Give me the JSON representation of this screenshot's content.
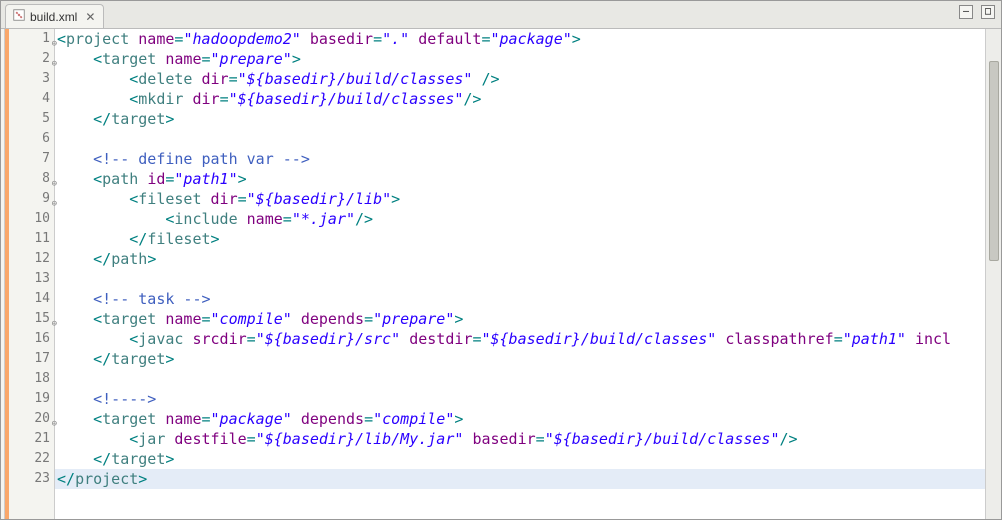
{
  "tab": {
    "filename": "build.xml",
    "close_glyph": "✕"
  },
  "fold_glyph": "⊖",
  "code": {
    "lines": [
      {
        "n": 1,
        "fold": true,
        "indent": 0,
        "segs": [
          {
            "c": "t-punc",
            "t": "<"
          },
          {
            "c": "t-tag",
            "t": "project"
          },
          {
            "c": "",
            "t": " "
          },
          {
            "c": "t-attr",
            "t": "name"
          },
          {
            "c": "t-punc",
            "t": "="
          },
          {
            "c": "t-str",
            "t": "\"hadoopdemo2\""
          },
          {
            "c": "",
            "t": " "
          },
          {
            "c": "t-attr",
            "t": "basedir"
          },
          {
            "c": "t-punc",
            "t": "="
          },
          {
            "c": "t-str",
            "t": "\".\""
          },
          {
            "c": "",
            "t": " "
          },
          {
            "c": "t-attr",
            "t": "default"
          },
          {
            "c": "t-punc",
            "t": "="
          },
          {
            "c": "t-str",
            "t": "\"package\""
          },
          {
            "c": "t-punc",
            "t": ">"
          }
        ]
      },
      {
        "n": 2,
        "fold": true,
        "indent": 1,
        "segs": [
          {
            "c": "t-punc",
            "t": "<"
          },
          {
            "c": "t-tag",
            "t": "target"
          },
          {
            "c": "",
            "t": " "
          },
          {
            "c": "t-attr",
            "t": "name"
          },
          {
            "c": "t-punc",
            "t": "="
          },
          {
            "c": "t-str",
            "t": "\"prepare\""
          },
          {
            "c": "t-punc",
            "t": ">"
          }
        ]
      },
      {
        "n": 3,
        "fold": false,
        "indent": 2,
        "segs": [
          {
            "c": "t-punc",
            "t": "<"
          },
          {
            "c": "t-tag",
            "t": "delete"
          },
          {
            "c": "",
            "t": " "
          },
          {
            "c": "t-attr",
            "t": "dir"
          },
          {
            "c": "t-punc",
            "t": "="
          },
          {
            "c": "t-str",
            "t": "\"${basedir}/build/classes\""
          },
          {
            "c": "",
            "t": " "
          },
          {
            "c": "t-punc",
            "t": "/>"
          }
        ]
      },
      {
        "n": 4,
        "fold": false,
        "indent": 2,
        "segs": [
          {
            "c": "t-punc",
            "t": "<"
          },
          {
            "c": "t-tag",
            "t": "mkdir"
          },
          {
            "c": "",
            "t": " "
          },
          {
            "c": "t-attr",
            "t": "dir"
          },
          {
            "c": "t-punc",
            "t": "="
          },
          {
            "c": "t-str",
            "t": "\"${basedir}/build/classes\""
          },
          {
            "c": "t-punc",
            "t": "/>"
          }
        ]
      },
      {
        "n": 5,
        "fold": false,
        "indent": 1,
        "segs": [
          {
            "c": "t-punc",
            "t": "</"
          },
          {
            "c": "t-tag",
            "t": "target"
          },
          {
            "c": "t-punc",
            "t": ">"
          }
        ]
      },
      {
        "n": 6,
        "fold": false,
        "indent": 0,
        "segs": []
      },
      {
        "n": 7,
        "fold": false,
        "indent": 1,
        "segs": [
          {
            "c": "t-cmt",
            "t": "<!-- define path var -->"
          }
        ]
      },
      {
        "n": 8,
        "fold": true,
        "indent": 1,
        "segs": [
          {
            "c": "t-punc",
            "t": "<"
          },
          {
            "c": "t-tag",
            "t": "path"
          },
          {
            "c": "",
            "t": " "
          },
          {
            "c": "t-attr",
            "t": "id"
          },
          {
            "c": "t-punc",
            "t": "="
          },
          {
            "c": "t-str",
            "t": "\"path1\""
          },
          {
            "c": "t-punc",
            "t": ">"
          }
        ]
      },
      {
        "n": 9,
        "fold": true,
        "indent": 2,
        "segs": [
          {
            "c": "t-punc",
            "t": "<"
          },
          {
            "c": "t-tag",
            "t": "fileset"
          },
          {
            "c": "",
            "t": " "
          },
          {
            "c": "t-attr",
            "t": "dir"
          },
          {
            "c": "t-punc",
            "t": "="
          },
          {
            "c": "t-str",
            "t": "\"${basedir}/lib\""
          },
          {
            "c": "t-punc",
            "t": ">"
          }
        ]
      },
      {
        "n": 10,
        "fold": false,
        "indent": 3,
        "segs": [
          {
            "c": "t-punc",
            "t": "<"
          },
          {
            "c": "t-tag",
            "t": "include"
          },
          {
            "c": "",
            "t": " "
          },
          {
            "c": "t-attr",
            "t": "name"
          },
          {
            "c": "t-punc",
            "t": "="
          },
          {
            "c": "t-str",
            "t": "\"*.jar\""
          },
          {
            "c": "t-punc",
            "t": "/>"
          }
        ]
      },
      {
        "n": 11,
        "fold": false,
        "indent": 2,
        "segs": [
          {
            "c": "t-punc",
            "t": "</"
          },
          {
            "c": "t-tag",
            "t": "fileset"
          },
          {
            "c": "t-punc",
            "t": ">"
          }
        ]
      },
      {
        "n": 12,
        "fold": false,
        "indent": 1,
        "segs": [
          {
            "c": "t-punc",
            "t": "</"
          },
          {
            "c": "t-tag",
            "t": "path"
          },
          {
            "c": "t-punc",
            "t": ">"
          }
        ]
      },
      {
        "n": 13,
        "fold": false,
        "indent": 0,
        "segs": []
      },
      {
        "n": 14,
        "fold": false,
        "indent": 1,
        "segs": [
          {
            "c": "t-cmt",
            "t": "<!-- task -->"
          }
        ]
      },
      {
        "n": 15,
        "fold": true,
        "indent": 1,
        "segs": [
          {
            "c": "t-punc",
            "t": "<"
          },
          {
            "c": "t-tag",
            "t": "target"
          },
          {
            "c": "",
            "t": " "
          },
          {
            "c": "t-attr",
            "t": "name"
          },
          {
            "c": "t-punc",
            "t": "="
          },
          {
            "c": "t-str",
            "t": "\"compile\""
          },
          {
            "c": "",
            "t": " "
          },
          {
            "c": "t-attr",
            "t": "depends"
          },
          {
            "c": "t-punc",
            "t": "="
          },
          {
            "c": "t-str",
            "t": "\"prepare\""
          },
          {
            "c": "t-punc",
            "t": ">"
          }
        ]
      },
      {
        "n": 16,
        "fold": false,
        "indent": 2,
        "segs": [
          {
            "c": "t-punc",
            "t": "<"
          },
          {
            "c": "t-tag",
            "t": "javac"
          },
          {
            "c": "",
            "t": " "
          },
          {
            "c": "t-attr",
            "t": "srcdir"
          },
          {
            "c": "t-punc",
            "t": "="
          },
          {
            "c": "t-str",
            "t": "\"${basedir}/src\""
          },
          {
            "c": "",
            "t": " "
          },
          {
            "c": "t-attr",
            "t": "destdir"
          },
          {
            "c": "t-punc",
            "t": "="
          },
          {
            "c": "t-str",
            "t": "\"${basedir}/build/classes\""
          },
          {
            "c": "",
            "t": " "
          },
          {
            "c": "t-attr",
            "t": "classpathref"
          },
          {
            "c": "t-punc",
            "t": "="
          },
          {
            "c": "t-str",
            "t": "\"path1\""
          },
          {
            "c": "",
            "t": " "
          },
          {
            "c": "t-attr",
            "t": "incl"
          }
        ]
      },
      {
        "n": 17,
        "fold": false,
        "indent": 1,
        "segs": [
          {
            "c": "t-punc",
            "t": "</"
          },
          {
            "c": "t-tag",
            "t": "target"
          },
          {
            "c": "t-punc",
            "t": ">"
          }
        ]
      },
      {
        "n": 18,
        "fold": false,
        "indent": 0,
        "segs": []
      },
      {
        "n": 19,
        "fold": false,
        "indent": 1,
        "segs": [
          {
            "c": "t-cmt",
            "t": "<!---->"
          }
        ]
      },
      {
        "n": 20,
        "fold": true,
        "indent": 1,
        "segs": [
          {
            "c": "t-punc",
            "t": "<"
          },
          {
            "c": "t-tag",
            "t": "target"
          },
          {
            "c": "",
            "t": " "
          },
          {
            "c": "t-attr",
            "t": "name"
          },
          {
            "c": "t-punc",
            "t": "="
          },
          {
            "c": "t-str",
            "t": "\"package\""
          },
          {
            "c": "",
            "t": " "
          },
          {
            "c": "t-attr",
            "t": "depends"
          },
          {
            "c": "t-punc",
            "t": "="
          },
          {
            "c": "t-str",
            "t": "\"compile\""
          },
          {
            "c": "t-punc",
            "t": ">"
          }
        ]
      },
      {
        "n": 21,
        "fold": false,
        "indent": 2,
        "segs": [
          {
            "c": "t-punc",
            "t": "<"
          },
          {
            "c": "t-tag",
            "t": "jar"
          },
          {
            "c": "",
            "t": " "
          },
          {
            "c": "t-attr",
            "t": "destfile"
          },
          {
            "c": "t-punc",
            "t": "="
          },
          {
            "c": "t-str",
            "t": "\"${basedir}/lib/My.jar\""
          },
          {
            "c": "",
            "t": " "
          },
          {
            "c": "t-attr",
            "t": "basedir"
          },
          {
            "c": "t-punc",
            "t": "="
          },
          {
            "c": "t-str",
            "t": "\"${basedir}/build/classes\""
          },
          {
            "c": "t-punc",
            "t": "/>"
          }
        ]
      },
      {
        "n": 22,
        "fold": false,
        "indent": 1,
        "segs": [
          {
            "c": "t-punc",
            "t": "</"
          },
          {
            "c": "t-tag",
            "t": "target"
          },
          {
            "c": "t-punc",
            "t": ">"
          }
        ]
      },
      {
        "n": 23,
        "fold": false,
        "indent": 0,
        "hl": true,
        "segs": [
          {
            "c": "t-punc",
            "t": "</"
          },
          {
            "c": "t-tag",
            "t": "project"
          },
          {
            "c": "t-punc",
            "t": ">"
          }
        ]
      }
    ]
  }
}
